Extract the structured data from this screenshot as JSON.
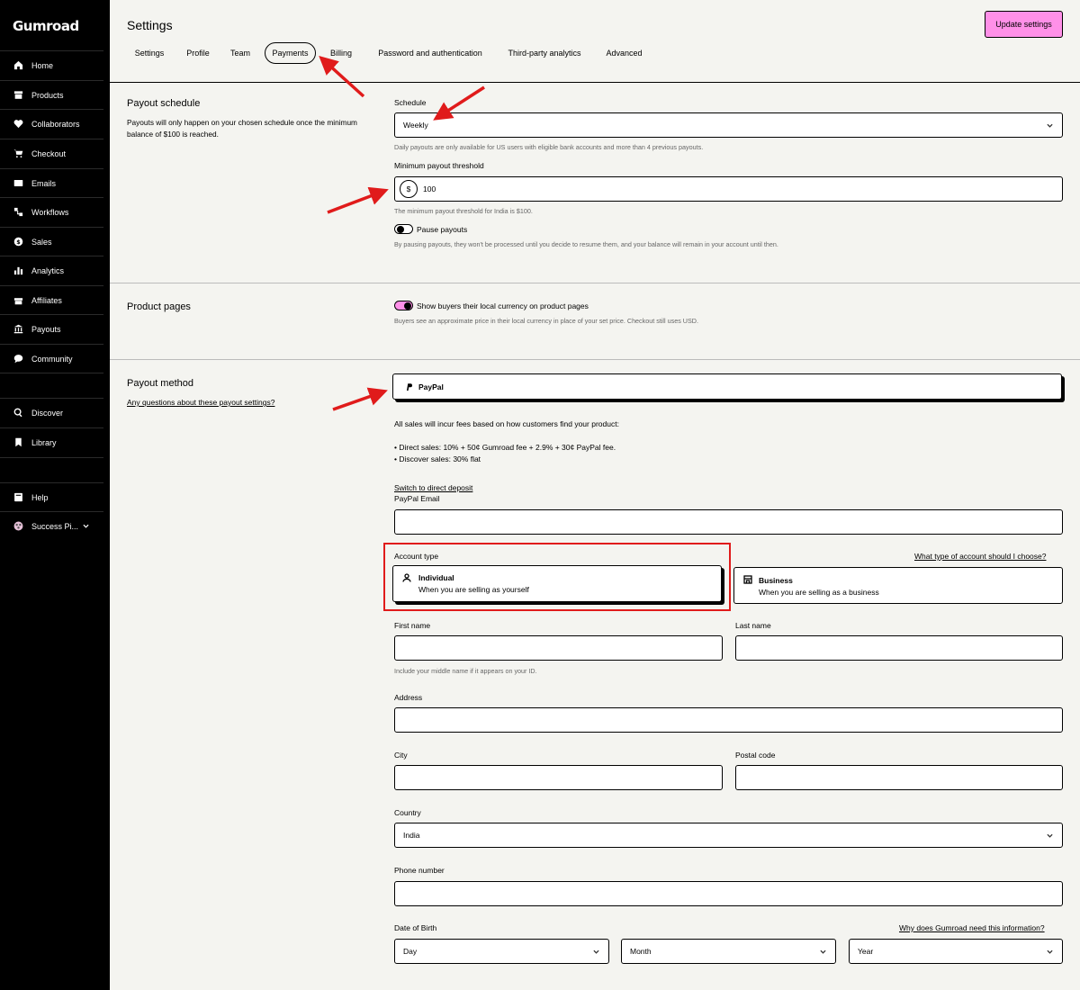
{
  "sidebar": {
    "logo": "Gumroad",
    "items": [
      {
        "label": "Home",
        "icon": "home-icon"
      },
      {
        "label": "Products",
        "icon": "archive-icon"
      },
      {
        "label": "Collaborators",
        "icon": "heart-handshake-icon"
      },
      {
        "label": "Checkout",
        "icon": "cart-icon"
      },
      {
        "label": "Emails",
        "icon": "envelope-icon"
      },
      {
        "label": "Workflows",
        "icon": "workflow-icon"
      },
      {
        "label": "Sales",
        "icon": "dollar-circle-icon"
      },
      {
        "label": "Analytics",
        "icon": "bar-chart-icon"
      },
      {
        "label": "Affiliates",
        "icon": "gift-icon"
      },
      {
        "label": "Payouts",
        "icon": "bank-icon"
      },
      {
        "label": "Community",
        "icon": "chat-bubble-icon"
      },
      {
        "label": "Discover",
        "icon": "search-icon"
      },
      {
        "label": "Library",
        "icon": "bookmark-icon"
      },
      {
        "label": "Help",
        "icon": "book-icon"
      },
      {
        "label": "Success Pi...",
        "icon": "avatar"
      }
    ]
  },
  "header": {
    "title": "Settings",
    "update_label": "Update settings",
    "tabs": [
      "Settings",
      "Profile",
      "Team",
      "Payments",
      "Billing",
      "Password and authentication",
      "Third-party analytics",
      "Advanced"
    ],
    "active_tab": "Payments"
  },
  "payout_schedule": {
    "title": "Payout schedule",
    "desc": "Payouts will only happen on your chosen schedule once the minimum balance of $100 is reached.",
    "schedule_label": "Schedule",
    "schedule_value": "Weekly",
    "schedule_hint": "Daily payouts are only available for US users with eligible bank accounts and more than 4 previous payouts.",
    "threshold_label": "Minimum payout threshold",
    "currency_symbol": "$",
    "threshold_value": "100",
    "threshold_hint": "The minimum payout threshold for India is $100.",
    "pause_label": "Pause payouts",
    "pause_on": false,
    "pause_hint": "By pausing payouts, they won't be processed until you decide to resume them, and your balance will remain in your account until then."
  },
  "product_pages": {
    "title": "Product pages",
    "local_currency_label": "Show buyers their local currency on product pages",
    "local_currency_on": true,
    "local_currency_hint": "Buyers see an approximate price in their local currency in place of your set price. Checkout still uses USD."
  },
  "payout_method": {
    "title": "Payout method",
    "help_link": "Any questions about these payout settings?",
    "method_label": "PayPal",
    "fees_intro": "All sales will incur fees based on how customers find your product:",
    "fee_direct": "• Direct sales: 10% + 50¢ Gumroad fee + 2.9% + 30¢ PayPal fee.",
    "fee_discover": "• Discover sales: 30% flat",
    "switch_link": "Switch to direct deposit",
    "paypal_email_label": "PayPal Email",
    "paypal_email_value": "",
    "account_type_label": "Account type",
    "account_type_help": "What type of account should I choose?",
    "individual_title": "Individual",
    "individual_desc": "When you are selling as yourself",
    "business_title": "Business",
    "business_desc": "When you are selling as a business",
    "first_name_label": "First name",
    "last_name_label": "Last name",
    "name_hint": "Include your middle name if it appears on your ID.",
    "address_label": "Address",
    "city_label": "City",
    "postal_label": "Postal code",
    "country_label": "Country",
    "country_value": "India",
    "phone_label": "Phone number",
    "dob_label": "Date of Birth",
    "dob_help": "Why does Gumroad need this information?",
    "dob_day": "Day",
    "dob_month": "Month",
    "dob_year": "Year"
  },
  "colors": {
    "accent_pink": "#ff90e8",
    "annotation_red": "#e01b1b",
    "background": "#f4f4f0",
    "sidebar": "#000000"
  }
}
